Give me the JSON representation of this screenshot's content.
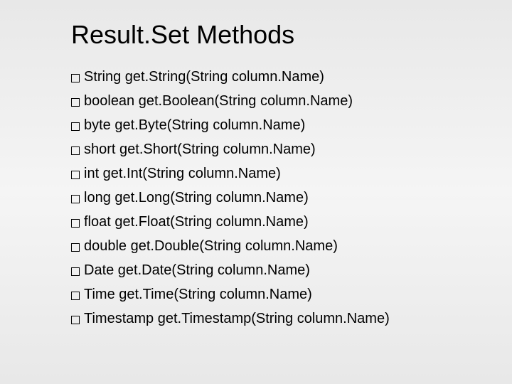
{
  "title": "Result.Set Methods",
  "methods": [
    "String get.String(String column.Name)",
    "boolean get.Boolean(String column.Name)",
    "byte get.Byte(String column.Name)",
    "short get.Short(String column.Name)",
    "int get.Int(String column.Name)",
    "long get.Long(String column.Name)",
    "float get.Float(String column.Name)",
    "double get.Double(String column.Name)",
    "Date get.Date(String column.Name)",
    "Time get.Time(String column.Name)",
    "Timestamp get.Timestamp(String column.Name)"
  ]
}
